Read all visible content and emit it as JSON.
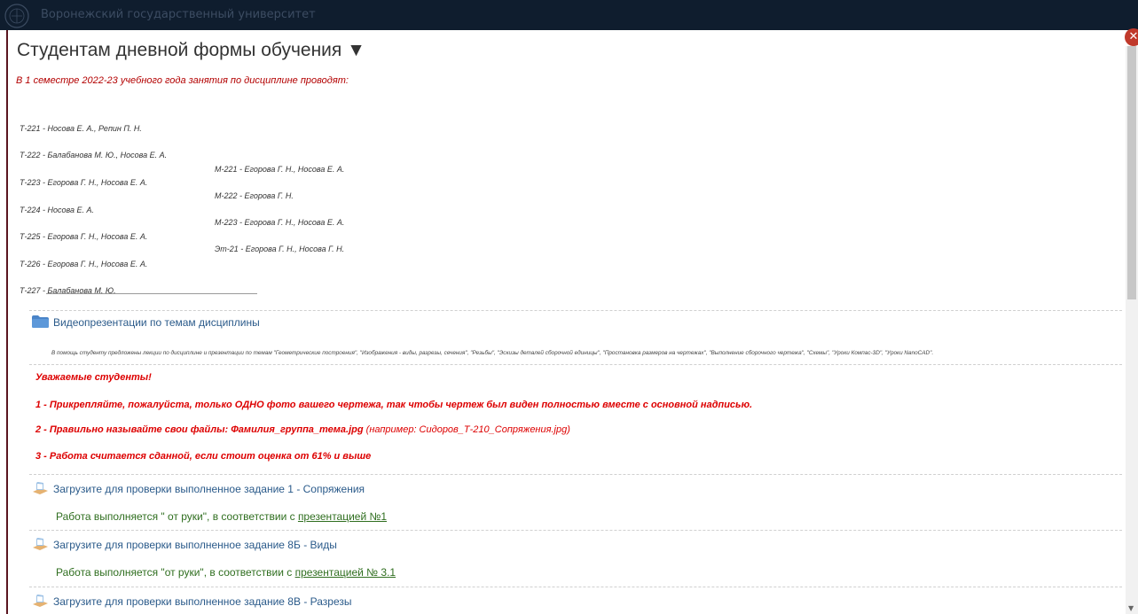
{
  "header": {
    "university": "Воронежский государственный университет"
  },
  "section": {
    "title": "Студентам дневной формы обучения ▼",
    "semester_note": "В 1 семестре 2022-23 учебного года занятия  по дисциплине проводят:",
    "groups_left": [
      "Т-221 - Носова Е. А., Репин П. Н.",
      "Т-222 - Балабанова М. Ю., Носова Е. А.",
      "Т-223 - Егорова Г. Н., Носова Е. А.",
      "Т-224 - Носова Е. А.",
      "Т-225 - Егорова Г. Н., Носова Е. А.",
      "Т-226 - Егорова Г. Н., Носова Е. А.",
      "Т-227 - Балабанова М. Ю."
    ],
    "groups_right": [
      "М-221 - Егорова Г. Н., Носова Е. А.",
      "М-222 - Егорова Г. Н.",
      "М-223 - Егорова Г. Н., Носова Е. А.",
      "Эт-21 - Егорова Г. Н., Носова Г. Н."
    ]
  },
  "video_folder": {
    "label": "Видеопрезентации по темам дисциплины",
    "description": "В помощь студенту предложены лекции по дисциплине и презентации по темам \"Геометрические построения\", \"Изображения - виды, разрезы, сечения\", \"Резьбы\", \"Эскизы деталей сборочной единицы\",  \"Простановка размеров на чертежах\", \"Выполнение сборочного чертежа\", \"Схемы\", \"Уроки Компас-3D\", \"Уроки NanoCAD\"."
  },
  "notice": {
    "heading": "Уважаемые студенты!",
    "rule1": "1 - Прикрепляйте, пожалуйста, только ОДНО фото вашего чертежа, так чтобы чертеж был виден полностью вместе с основной надписью.",
    "rule2_bold": "2 - Правильно называйте свои файлы: Фамилия_группа_тема.jpg",
    "rule2_note": "(например: Сидоров_Т-210_Сопряжения.jpg)",
    "rule3": "3 - Работа считается сданной, если стоит оценка от 61% и выше"
  },
  "assignments": [
    {
      "title": "Загрузите для проверки выполненное задание 1 - Сопряжения",
      "note_prefix": "Работа  выполняется \" от руки\", в соответствии с ",
      "note_link": "презентацией №1"
    },
    {
      "title": "Загрузите для проверки выполненное задание 8Б - Виды",
      "note_prefix": "Работа выполняется \"от руки\", в соответствии с ",
      "note_link": "презентацией № 3.1"
    },
    {
      "title": "Загрузите для проверки выполненное задание 8В - Разрезы"
    }
  ],
  "controls": {
    "close_glyph": "✕",
    "scroll_down_glyph": "▼"
  },
  "colors": {
    "topbar": "#0f1d2e",
    "red_text": "#dd0000",
    "link_blue": "#2a5a8a",
    "green_text": "#2f6e1f",
    "close_red": "#c0392b"
  }
}
